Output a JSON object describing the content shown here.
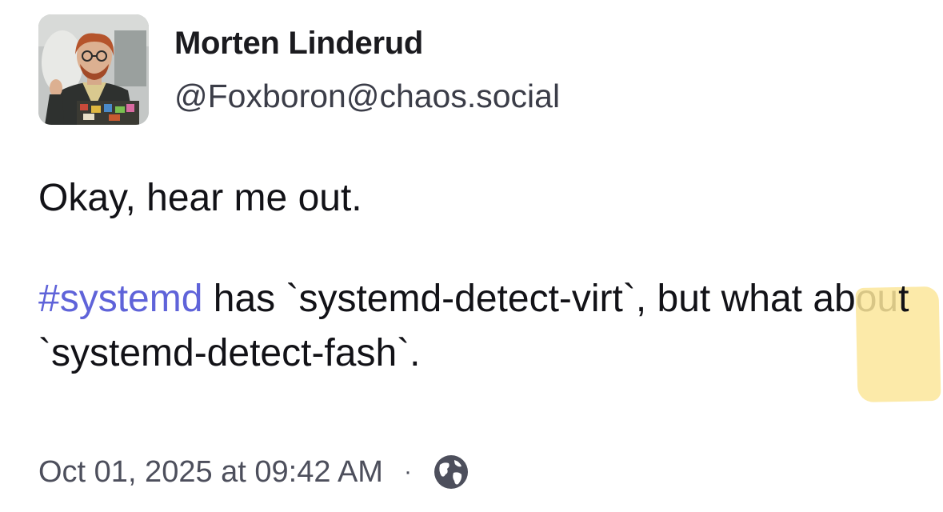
{
  "author": {
    "display_name": "Morten Linderud",
    "handle": "@Foxboron@chaos.social"
  },
  "post": {
    "line1": "Okay, hear me out.",
    "hashtag": "#systemd",
    "text_after_hashtag": " has `systemd-detect-virt`, but what abou",
    "highlighted": "t `systemd-detect-fash`",
    "text_end": "."
  },
  "meta": {
    "timestamp": "Oct 01, 2025 at 09:42 AM",
    "separator": "·",
    "visibility_icon": "globe-icon"
  },
  "colors": {
    "hashtag": "#5f63d9",
    "highlight": "#fbe69a",
    "meta_text": "#4d4f5c"
  }
}
